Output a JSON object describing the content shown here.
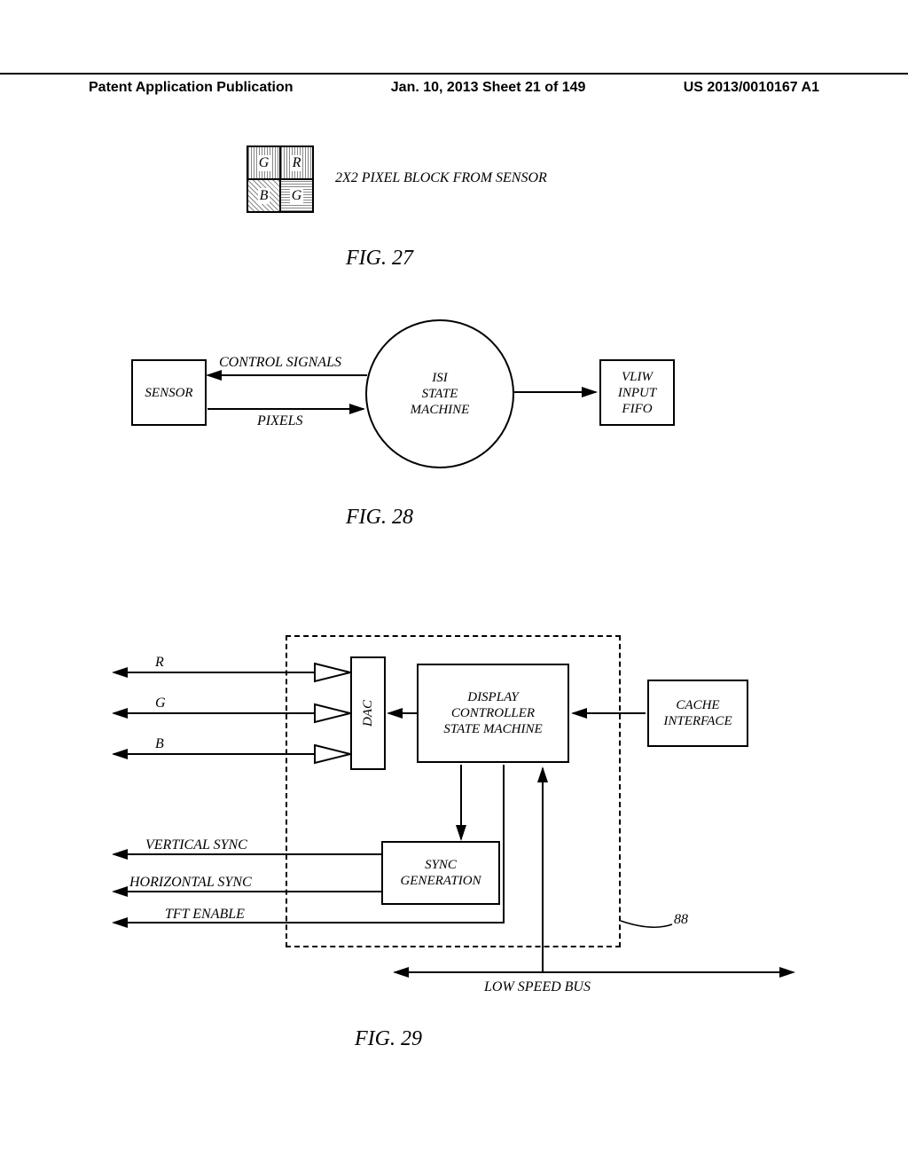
{
  "header": {
    "left": "Patent Application Publication",
    "center": "Jan. 10, 2013  Sheet 21 of 149",
    "right": "US 2013/0010167 A1"
  },
  "fig27": {
    "pixels": {
      "tl": "G",
      "tr": "R",
      "bl": "B",
      "br": "G"
    },
    "caption_right": "2X2 PIXEL BLOCK FROM SENSOR",
    "caption": "FIG. 27"
  },
  "fig28": {
    "sensor": "SENSOR",
    "control_signals": "CONTROL SIGNALS",
    "pixels_label": "PIXELS",
    "isi": "ISI\nSTATE\nMACHINE",
    "vliw": "VLIW\nINPUT\nFIFO",
    "caption": "FIG. 28"
  },
  "fig29": {
    "r": "R",
    "g": "G",
    "b": "B",
    "dac": "DAC",
    "controller": "DISPLAY\nCONTROLLER\nSTATE MACHINE",
    "cache": "CACHE\nINTERFACE",
    "vsync": "VERTICAL SYNC",
    "hsync": "HORIZONTAL SYNC",
    "tft": "TFT ENABLE",
    "sync_gen": "SYNC\nGENERATION",
    "ref_88": "88",
    "bus": "LOW SPEED BUS",
    "caption": "FIG. 29"
  }
}
